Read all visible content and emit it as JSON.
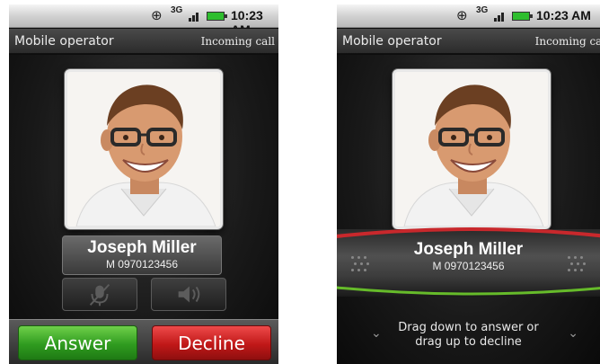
{
  "screens": [
    {
      "status": {
        "time": "10:23 AM",
        "network": "3G",
        "icons": [
          "gps-icon",
          "3g-icon",
          "signal-icon",
          "battery-icon"
        ]
      },
      "header": {
        "operator": "Mobile operator",
        "state": "Incoming call"
      },
      "caller": {
        "name": "Joseph Miller",
        "number": "M 0970123456"
      },
      "controls": [
        {
          "icon": "mute-microphone-icon"
        },
        {
          "icon": "speaker-icon"
        }
      ],
      "actions": {
        "answer": "Answer",
        "decline": "Decline"
      }
    },
    {
      "status": {
        "time": "10:23 AM",
        "network": "3G",
        "icons": [
          "gps-icon",
          "3g-icon",
          "signal-icon",
          "battery-icon"
        ]
      },
      "header": {
        "operator": "Mobile operator",
        "state": "Incoming call"
      },
      "caller": {
        "name": "Joseph Miller",
        "number": "M 0970123456"
      },
      "hint_line1": "Drag down to answer or",
      "hint_line2": "drag up to decline"
    }
  ],
  "colors": {
    "answer": "#2f9b1f",
    "decline": "#c01818",
    "slider_top": "#c8282c",
    "slider_bottom": "#66bb2a"
  }
}
